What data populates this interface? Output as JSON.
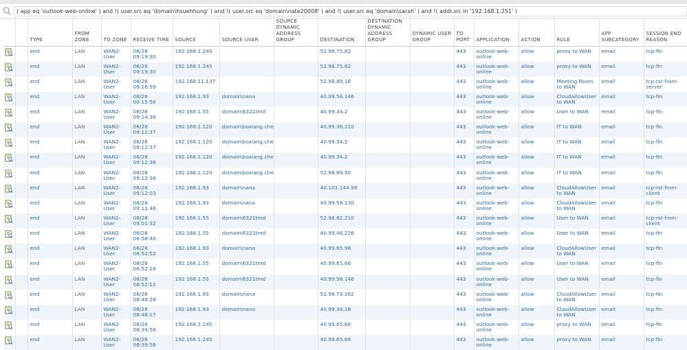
{
  "filter": {
    "query": "( app eq 'outlook-web-online' ) and !( user.src eq 'domain\\hsuehhung' ) and !( user.src eq 'domain\\nate20008' ) and !( user.src eq 'domain\\sarah' )  and !( addr.src in '192.168.1.251' )"
  },
  "columns": [
    "",
    "",
    "TYPE",
    "FROM ZONE",
    "TO ZONE",
    "RECEIVE TIME",
    "SOURCE",
    "SOURCE USER",
    "SOURCE DYNAMIC ADDRESS GROUP",
    "DESTINATION",
    "DESTINATION DYNAMIC ADDRESS GROUP",
    "DYNAMIC USER GROUP",
    "TO PORT",
    "APPLICATION",
    "ACTION",
    "RULE",
    "APP SUBCATEGORY",
    "SESSION END REASON"
  ],
  "rows": [
    [
      "end",
      "LAN",
      "WAN2-User",
      "08/28 09:19:30",
      "192.168.1.245",
      "",
      "",
      "52.98.75.82",
      "",
      "",
      "443",
      "outlook-web-online",
      "allow",
      "proxy to WAN",
      "email",
      "tcp-fin"
    ],
    [
      "end",
      "LAN",
      "WAN2-User",
      "08/28 09:19:30",
      "192.168.1.245",
      "",
      "",
      "52.98.75.82",
      "",
      "",
      "443",
      "outlook-web-online",
      "allow",
      "proxy to WAN",
      "email",
      "tcp-fin"
    ],
    [
      "end",
      "LAN",
      "WAN2-User",
      "08/28 09:16:59",
      "192.168.11.137",
      "",
      "",
      "52.98.89.18",
      "",
      "",
      "443",
      "outlook-web-online",
      "allow",
      "Meeting Room to WAN",
      "email",
      "tcp-rst-from-server"
    ],
    [
      "end",
      "LAN",
      "WAN2-User",
      "08/28 09:15:50",
      "192.168.1.93",
      "domain\\nana",
      "",
      "40.99.58.146",
      "",
      "",
      "443",
      "outlook-web-online",
      "allow",
      "CloudAllowUser to WAN",
      "email",
      "tcp-fin"
    ],
    [
      "end",
      "LAN",
      "WAN2-User",
      "08/28 09:14:36",
      "192.168.1.55",
      "domain\\6321tmd",
      "",
      "40.99.34.2",
      "",
      "",
      "443",
      "outlook-web-online",
      "allow",
      "User to WAN",
      "email",
      "tcp-fin"
    ],
    [
      "end",
      "LAN",
      "WAN2-User",
      "08/28 09:12:37",
      "192.168.1.120",
      "domain\\boxiang.chen",
      "",
      "40.99.36.210",
      "",
      "",
      "443",
      "outlook-web-online",
      "allow",
      "IT to WAN",
      "email",
      "tcp-fin"
    ],
    [
      "end",
      "LAN",
      "WAN2-User",
      "08/28 09:12:37",
      "192.168.1.120",
      "domain\\boxiang.chen",
      "",
      "40.99.34.2",
      "",
      "",
      "443",
      "outlook-web-online",
      "allow",
      "IT to WAN",
      "email",
      "tcp-fin"
    ],
    [
      "end",
      "LAN",
      "WAN2-User",
      "08/28 09:12:36",
      "192.168.1.120",
      "domain\\boxiang.chen",
      "",
      "40.99.34.2",
      "",
      "",
      "443",
      "outlook-web-online",
      "allow",
      "IT to WAN",
      "email",
      "tcp-fin"
    ],
    [
      "end",
      "LAN",
      "WAN2-User",
      "08/28 09:12:36",
      "192.168.1.120",
      "domain\\boxiang.chen",
      "",
      "52.98.89.50",
      "",
      "",
      "443",
      "outlook-web-online",
      "allow",
      "IT to WAN",
      "email",
      "tcp-fin"
    ],
    [
      "end",
      "LAN",
      "WAN2-User",
      "08/28 09:12:03",
      "192.168.1.93",
      "domain\\nana",
      "",
      "40.101.144.98",
      "",
      "",
      "443",
      "outlook-web-online",
      "allow",
      "CloudAllowUser to WAN",
      "email",
      "tcp-rst-from-client"
    ],
    [
      "end",
      "LAN",
      "WAN2-User",
      "08/28 09:11:46",
      "192.168.1.93",
      "domain\\nana",
      "",
      "40.99.58.130",
      "",
      "",
      "443",
      "outlook-web-online",
      "allow",
      "CloudAllowUser to WAN",
      "email",
      "tcp-fin"
    ],
    [
      "end",
      "LAN",
      "WAN2-User",
      "08/28 09:01:32",
      "192.168.1.55",
      "domain\\6321tmd",
      "",
      "52.98.82.210",
      "",
      "",
      "443",
      "outlook-web-online",
      "allow",
      "User to WAN",
      "email",
      "tcp-rst-from-client"
    ],
    [
      "end",
      "LAN",
      "WAN2-User",
      "08/28 08:58:40",
      "192.168.1.55",
      "domain\\6321tmd",
      "",
      "40.99.46.226",
      "",
      "",
      "443",
      "outlook-web-online",
      "allow",
      "User to WAN",
      "email",
      "tcp-fin"
    ],
    [
      "end",
      "LAN",
      "WAN2-User",
      "08/28 08:52:52",
      "192.168.1.93",
      "domain\\nana",
      "",
      "40.99.65.98",
      "",
      "",
      "443",
      "outlook-web-online",
      "allow",
      "CloudAllowUser to WAN",
      "email",
      "tcp-fin"
    ],
    [
      "end",
      "LAN",
      "WAN2-User",
      "08/28 08:52:18",
      "192.168.1.55",
      "domain\\6321tmd",
      "",
      "40.99.65.66",
      "",
      "",
      "443",
      "outlook-web-online",
      "allow",
      "User to WAN",
      "email",
      "tcp-fin"
    ],
    [
      "end",
      "LAN",
      "WAN2-User",
      "08/28 08:52:12",
      "192.168.1.55",
      "domain\\6321tmd",
      "",
      "40.99.58.146",
      "",
      "",
      "443",
      "outlook-web-online",
      "allow",
      "User to WAN",
      "email",
      "tcp-fin"
    ],
    [
      "end",
      "LAN",
      "WAN2-User",
      "08/28 08:48:28",
      "192.168.1.93",
      "domain\\nana",
      "",
      "52.98.79.162",
      "",
      "",
      "443",
      "outlook-web-online",
      "allow",
      "CloudAllowUser to WAN",
      "email",
      "tcp-fin"
    ],
    [
      "end",
      "LAN",
      "WAN2-User",
      "08/28 08:48:17",
      "192.168.1.93",
      "domain\\nana",
      "",
      "40.99.34.18",
      "",
      "",
      "443",
      "outlook-web-online",
      "allow",
      "CloudAllowUser to WAN",
      "email",
      "tcp-fin"
    ],
    [
      "end",
      "LAN",
      "WAN2-User",
      "08/28 08:39:56",
      "192.168.1.245",
      "",
      "",
      "40.99.65.66",
      "",
      "",
      "443",
      "outlook-web-online",
      "allow",
      "proxy to WAN",
      "email",
      "tcp-fin"
    ],
    [
      "end",
      "LAN",
      "WAN2-User",
      "08/28 08:39:56",
      "192.168.1.245",
      "",
      "",
      "40.99.65.66",
      "",
      "",
      "443",
      "outlook-web-online",
      "allow",
      "proxy to WAN",
      "email",
      "tcp-fin"
    ]
  ]
}
